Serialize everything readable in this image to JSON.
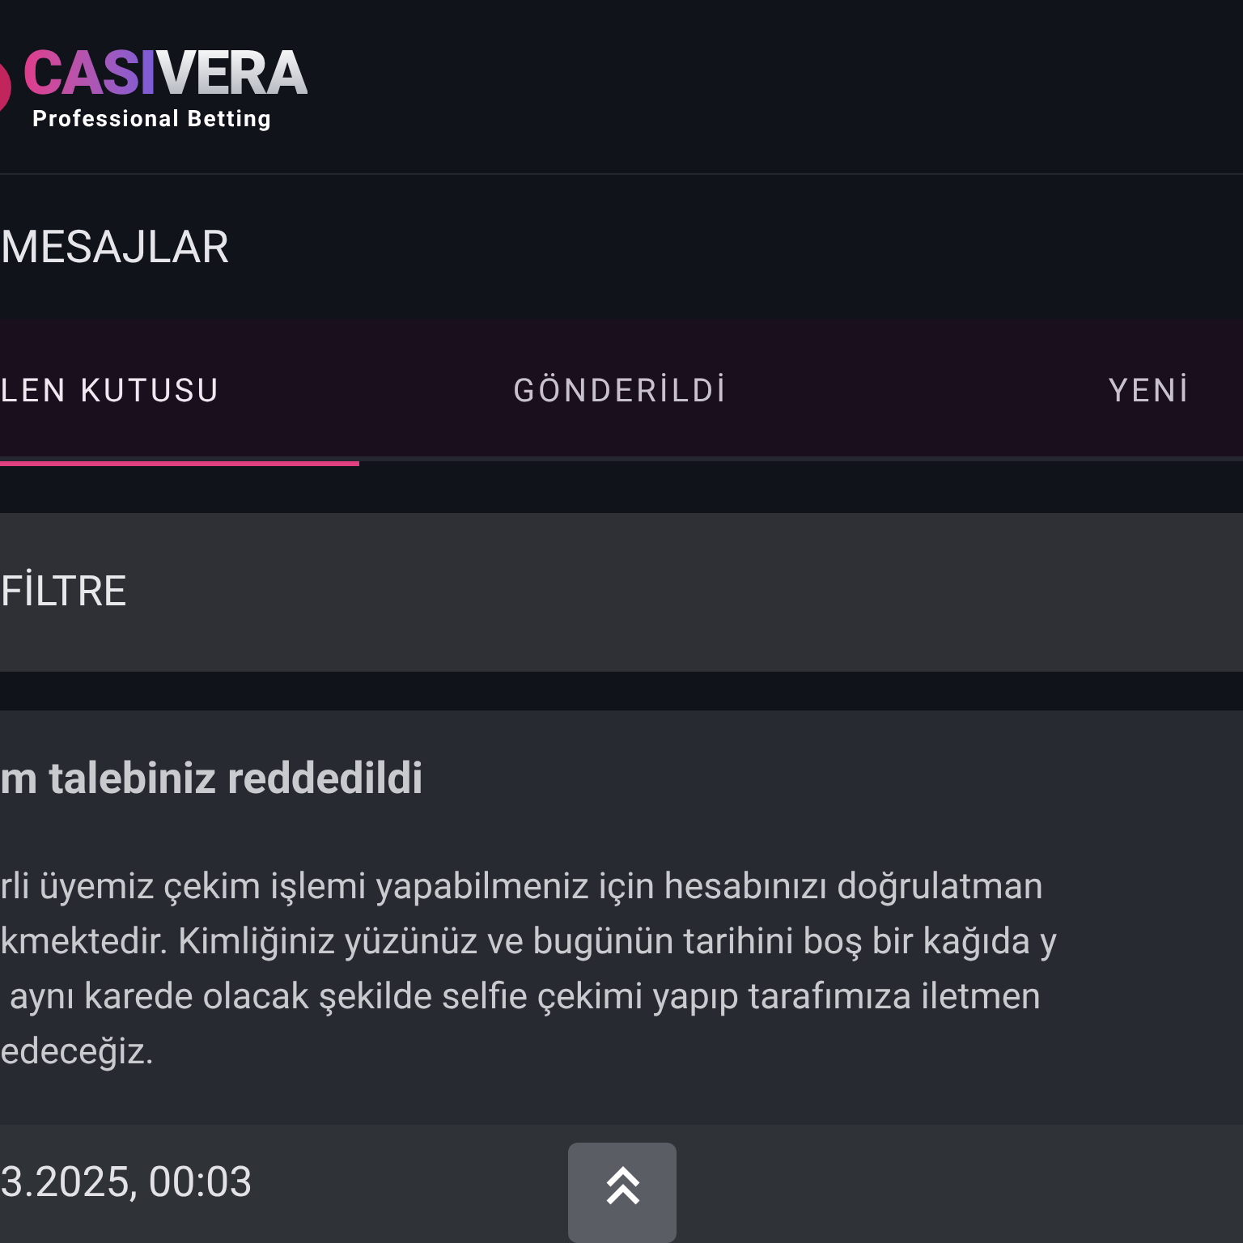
{
  "logo": {
    "brand_left": "CASI",
    "brand_right": "VERA",
    "tagline": "Professional Betting"
  },
  "page_title": "MESAJLAR",
  "tabs": [
    {
      "label": "LEN KUTUSU",
      "selected": true
    },
    {
      "label": "GÖNDERİLDİ",
      "selected": false
    },
    {
      "label": "YENİ",
      "selected": false
    }
  ],
  "filter": {
    "label": "FİLTRE"
  },
  "message": {
    "title": "m talebiniz reddedildi",
    "body_lines": [
      "rli üyemiz çekim işlemi yapabilmeniz için hesabınızı doğrulatman",
      "kmektedir. Kimliğiniz yüzünüz ve bugünün tarihini boş bir kağıda y",
      " aynı karede olacak şekilde selfie çekimi yapıp tarafımıza iletmen",
      "edeceğiz."
    ],
    "date": "3.2025, 00:03"
  }
}
